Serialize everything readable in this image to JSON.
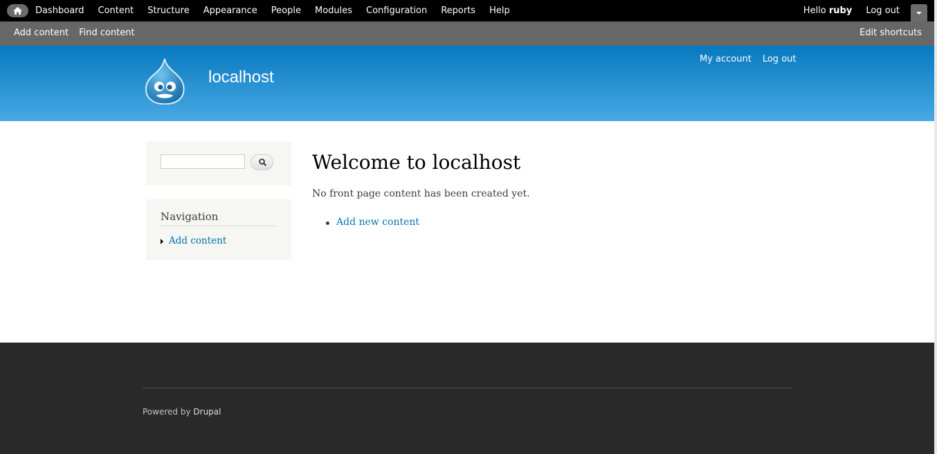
{
  "toolbar": {
    "menu": [
      "Dashboard",
      "Content",
      "Structure",
      "Appearance",
      "People",
      "Modules",
      "Configuration",
      "Reports",
      "Help"
    ],
    "hello_prefix": "Hello",
    "username": "ruby",
    "logout": "Log out"
  },
  "shortcuts": {
    "items": [
      "Add content",
      "Find content"
    ],
    "edit": "Edit shortcuts"
  },
  "header": {
    "site_name": "localhost",
    "secondary_menu": [
      "My account",
      "Log out"
    ]
  },
  "sidebar": {
    "search": {
      "value": ""
    },
    "navigation": {
      "title": "Navigation",
      "items": [
        "Add content"
      ]
    }
  },
  "main": {
    "title": "Welcome to localhost",
    "text": "No front page content has been created yet.",
    "links": [
      "Add new content"
    ]
  },
  "footer": {
    "powered_by": "Powered by",
    "brand": "Drupal"
  },
  "colors": {
    "toolbar_bg": "#000000",
    "shortcuts_bg": "#676767",
    "header_gradient_top": "#0779bf",
    "header_gradient_bottom": "#48a9e4",
    "link": "#0071b3",
    "footer_bg": "#292929"
  }
}
